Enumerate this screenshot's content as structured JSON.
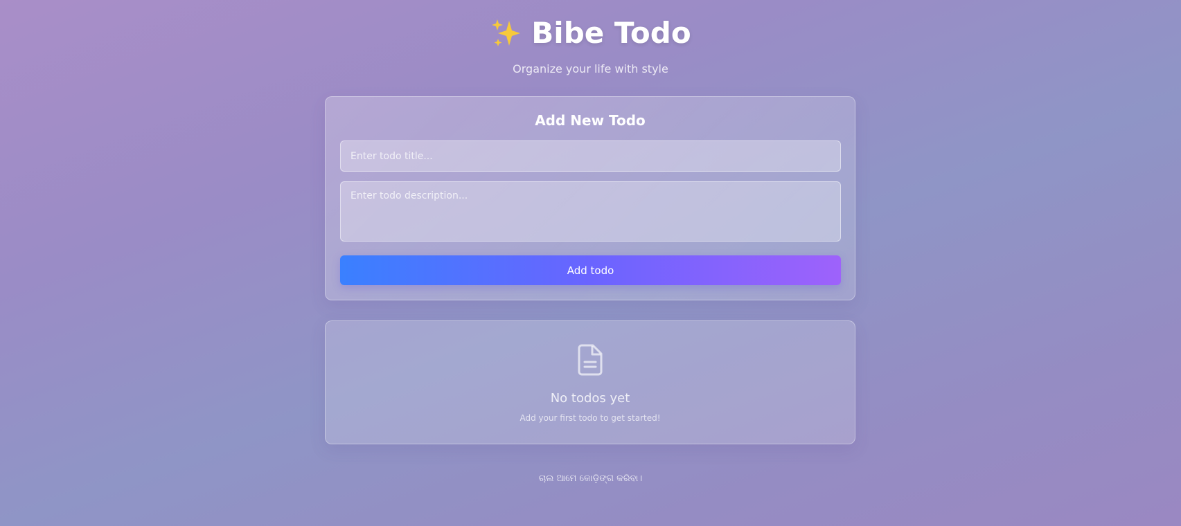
{
  "header": {
    "title_text": "Bibe Todo",
    "sparkle_icon": "sparkles-icon",
    "subtitle": "Organize your life with style"
  },
  "add_form": {
    "heading": "Add New Todo",
    "title_placeholder": "Enter todo title...",
    "title_value": "",
    "description_placeholder": "Enter todo description...",
    "description_value": "",
    "button_label": "Add todo"
  },
  "empty_state": {
    "icon": "document-icon",
    "title": "No todos yet",
    "subtitle": "Add your first todo to get started!"
  },
  "footer": {
    "text": "ଚାଲ ଆମେ କୋଡ଼ିଙ୍ଗ କରିବା।"
  },
  "colors": {
    "button_gradient_start": "#3a80ff",
    "button_gradient_end": "#9e62fb",
    "sparkle": "#f7c93a"
  }
}
